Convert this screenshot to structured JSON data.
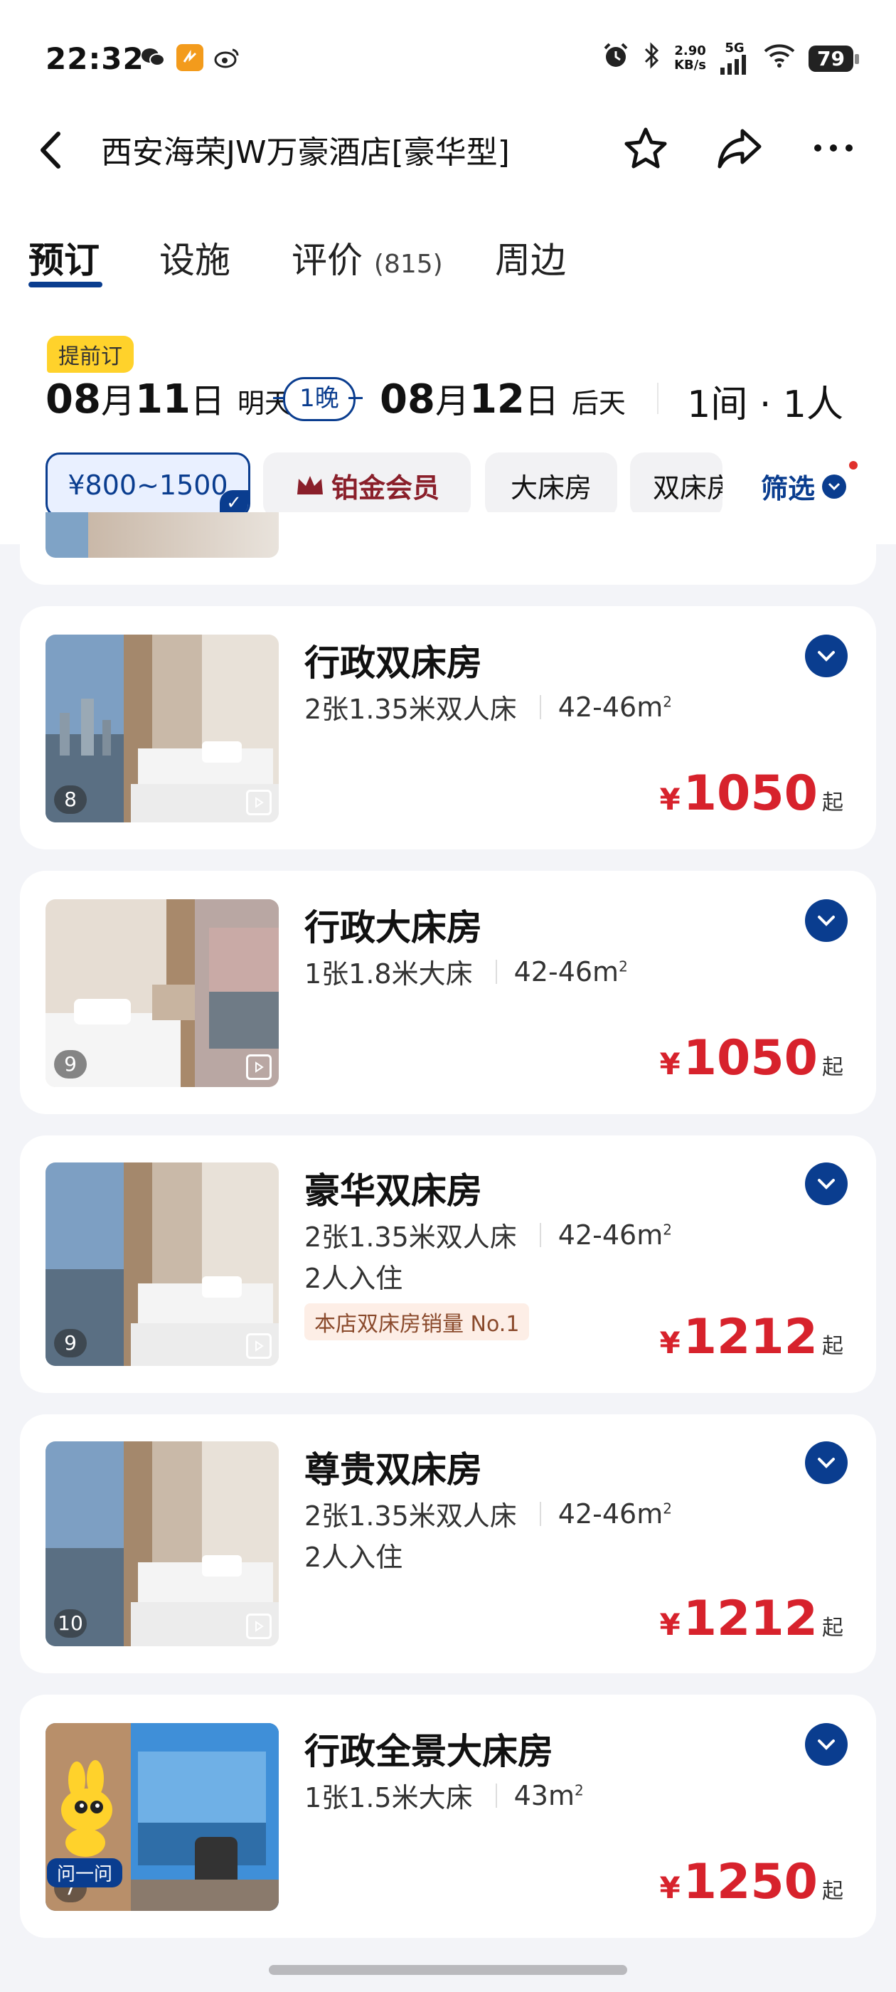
{
  "status_bar": {
    "time": "22:32",
    "speed_value": "2.90",
    "speed_unit": "KB/s",
    "network": "5G",
    "battery": "79"
  },
  "header": {
    "title": "西安海荣JW万豪酒店[豪华型]"
  },
  "tabs": [
    {
      "label": "预订"
    },
    {
      "label": "设施"
    },
    {
      "label": "评价",
      "count": "(815)"
    },
    {
      "label": "周边"
    }
  ],
  "booking": {
    "badge": "提前订",
    "checkin_month": "08",
    "checkin_day": "11",
    "checkin_sub": "明天",
    "nights": "1晚",
    "checkout_month": "08",
    "checkout_day": "12",
    "checkout_sub": "后天",
    "month_unit": "月",
    "day_unit": "日",
    "rooms_guests": "1间 · 1人"
  },
  "filters": {
    "chips": [
      "¥800~1500",
      "铂金会员",
      "大床房",
      "双床房"
    ],
    "filter_label": "筛选"
  },
  "rooms": [
    {
      "name": "行政双床房",
      "bed": "2张1.35米双人床",
      "area": "42-46m",
      "area_sup": "2",
      "price": "1050",
      "photos": "8",
      "occupancy": "",
      "tag": ""
    },
    {
      "name": "行政大床房",
      "bed": "1张1.8米大床",
      "area": "42-46m",
      "area_sup": "2",
      "price": "1050",
      "photos": "9",
      "occupancy": "",
      "tag": ""
    },
    {
      "name": "豪华双床房",
      "bed": "2张1.35米双人床",
      "area": "42-46m",
      "area_sup": "2",
      "price": "1212",
      "photos": "9",
      "occupancy": "2人入住",
      "tag": "本店双床房销量 No.1"
    },
    {
      "name": "尊贵双床房",
      "bed": "2张1.35米双人床",
      "area": "42-46m",
      "area_sup": "2",
      "price": "1212",
      "photos": "10",
      "occupancy": "2人入住",
      "tag": ""
    },
    {
      "name": "行政全景大床房",
      "bed": "1张1.5米大床",
      "area": "43m",
      "area_sup": "2",
      "price": "1250",
      "photos": "7",
      "occupancy": "",
      "tag": ""
    }
  ],
  "price_currency": "¥",
  "price_suffix": "起",
  "ask_label": "问一问",
  "colors": {
    "brand_blue": "#0a3d8f",
    "price_red": "#d7222c",
    "badge_yellow": "#ffd22b"
  }
}
